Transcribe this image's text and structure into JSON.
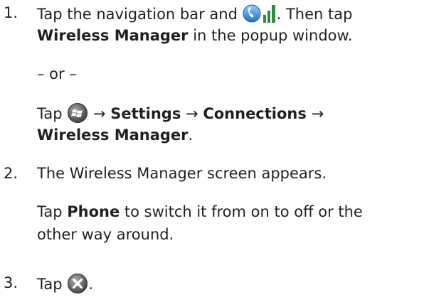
{
  "steps": [
    {
      "number": "1.",
      "line1_a": "Tap the navigation bar and ",
      "line1_b": ". Then tap",
      "line2_bold": "Wireless Manager",
      "line2_rest": " in the popup window.",
      "or": "– or –",
      "alt_tap": "Tap ",
      "arrow": "→",
      "settings": "Settings",
      "connections": "Connections",
      "alt_line2_bold": "Wireless Manager",
      "alt_line2_end": "."
    },
    {
      "number": "2.",
      "line1": "The Wireless Manager screen appears.",
      "tap": "Tap ",
      "phone": "Phone",
      "rest1": " to switch it from on to off or the",
      "rest2": "other way around."
    },
    {
      "number": "3.",
      "tap": "Tap ",
      "end": "."
    }
  ],
  "icons": {
    "phone_signal": "phone-signal-icon",
    "start": "windows-start-icon",
    "close": "close-icon"
  }
}
